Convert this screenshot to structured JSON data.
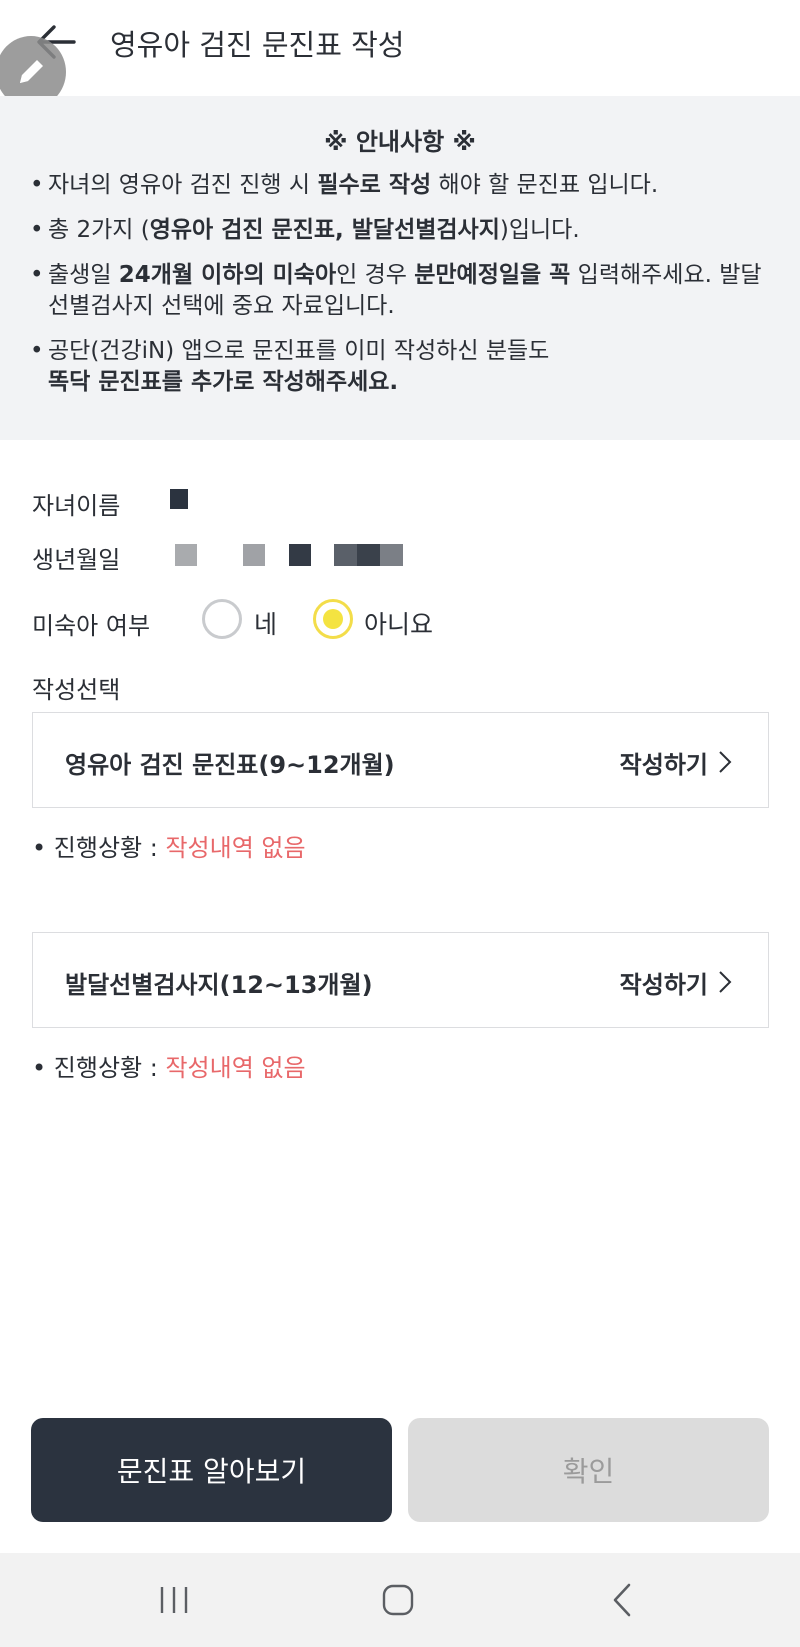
{
  "header": {
    "title": "영유아 검진 문진표 작성"
  },
  "notice": {
    "title": "※ 안내사항 ※",
    "items": [
      {
        "pre": "자녀의 영유아 검진 진행 시 ",
        "bold": "필수로 작성",
        "post": " 해야 할 문진표 입니다."
      },
      {
        "pre": "총 2가지 (",
        "bold": "영유아 검진 문진표, 발달선별검사지",
        "post": ")입니다."
      },
      {
        "pre": "출생일 ",
        "bold": "24개월 이하의 미숙아",
        "mid": "인 경우 ",
        "bold2": "분만예정일을 꼭",
        "post": " 입력해주세요. 발달선별검사지 선택에 중요 자료입니다."
      },
      {
        "pre": "공단(건강iN) 앱으로 문진표를 이미 작성하신 분들도",
        "bold": "똑닥 문진표를 추가로 작성해주세요.",
        "post": ""
      }
    ]
  },
  "form": {
    "child_name_label": "자녀이름",
    "birthdate_label": "생년월일",
    "premature_label": "미숙아 여부",
    "premature_options": [
      "네",
      "아니요"
    ],
    "premature_selected": "아니요",
    "select_label": "작성선택"
  },
  "cards": [
    {
      "title": "영유아 검진 문진표(9~12개월)",
      "action": "작성하기",
      "status_prefix": "• 진행상황 : ",
      "status_value": "작성내역 없음"
    },
    {
      "title": "발달선별검사지(12~13개월)",
      "action": "작성하기",
      "status_prefix": "• 진행상황 : ",
      "status_value": "작성내역 없음"
    }
  ],
  "buttons": {
    "learn": "문진표 알아보기",
    "confirm": "확인"
  },
  "colors": {
    "dark": "#2b333f",
    "accent_yellow": "#f4e341",
    "status_red": "#e8686a",
    "notice_bg": "#f2f3f5"
  }
}
